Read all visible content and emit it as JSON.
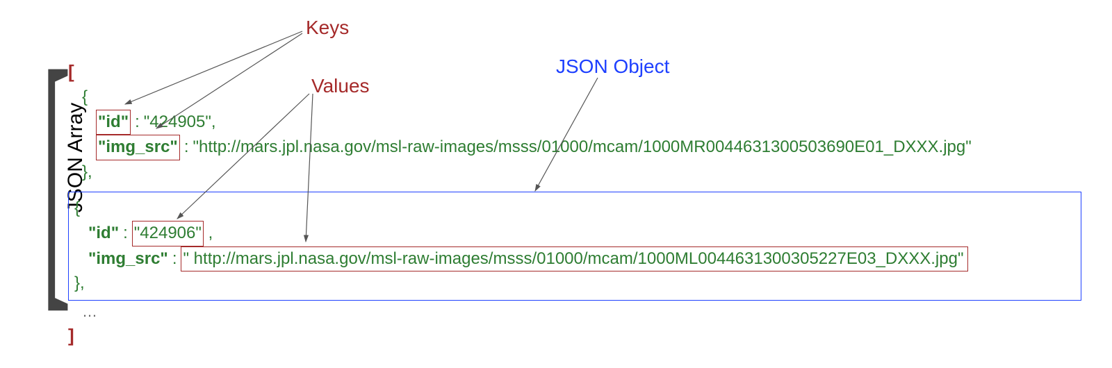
{
  "sideLabel": "JSON Array",
  "annotations": {
    "keys": "Keys",
    "values": "Values",
    "object": "JSON Object"
  },
  "syntax": {
    "arrayOpen": "[",
    "arrayClose": "]",
    "braceOpen": "{",
    "braceClose": "}",
    "ellipsis": "…"
  },
  "objects": [
    {
      "id_key": "\"id\"",
      "id_val": "\"424905\"",
      "src_key": "\"img_src\"",
      "src_val": "\"http://mars.jpl.nasa.gov/msl-raw-images/msss/01000/mcam/1000MR0044631300503690E01_DXXX.jpg\""
    },
    {
      "id_key": "\"id\"",
      "id_val": "\"424906\"",
      "src_key": "\"img_src\"",
      "src_val": "\" http://mars.jpl.nasa.gov/msl-raw-images/msss/01000/mcam/1000ML0044631300305227E03_DXXX.jpg\""
    }
  ]
}
